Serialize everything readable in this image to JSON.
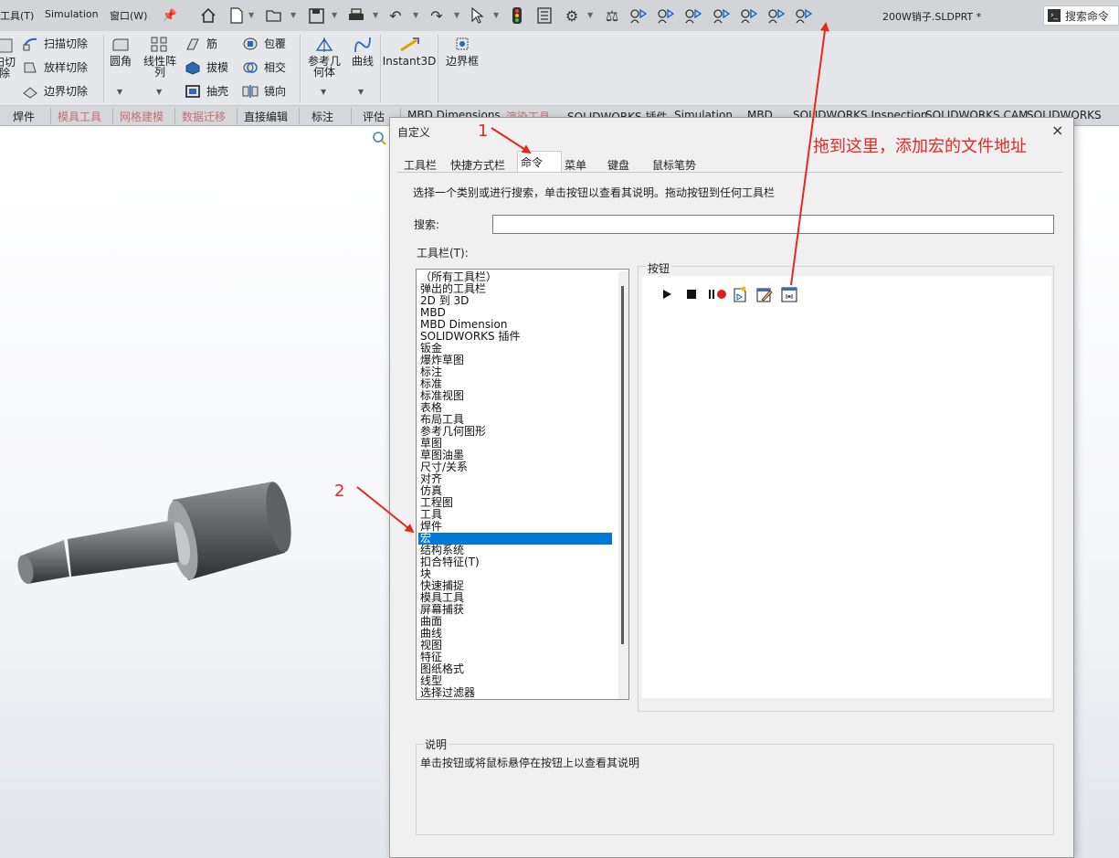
{
  "titlebar": {
    "menus": [
      "工具(T)",
      "Simulation",
      "窗口(W)"
    ],
    "document_title": "200W销子.SLDPRT *",
    "search_placeholder": "搜索命令"
  },
  "ribbon": {
    "partial_left": [
      "扫切",
      "除"
    ],
    "sweep_cut": "扫描切除",
    "loft_cut": "放样切除",
    "boundary_cut": "边界切除",
    "fillet": "圆角",
    "linear_pattern": "线性阵列",
    "rib": "筋",
    "draft": "拔模",
    "shell": "抽壳",
    "wrap": "包覆",
    "intersect": "相交",
    "mirror": "镜向",
    "ref_geometry": "参考几何体",
    "curves": "曲线",
    "instant3d": "Instant3D",
    "bounding_box": "边界框"
  },
  "tabs": [
    {
      "label": "焊件",
      "dim": false
    },
    {
      "label": "模具工具",
      "dim": true
    },
    {
      "label": "网格建模",
      "dim": true
    },
    {
      "label": "数据迁移",
      "dim": true
    },
    {
      "label": "直接编辑",
      "dim": false
    },
    {
      "label": "标注",
      "dim": false
    },
    {
      "label": "评估",
      "dim": false
    },
    {
      "label": "MBD Dimensions",
      "dim": false
    },
    {
      "label": "渲染工具",
      "dim": true
    },
    {
      "label": "SOLIDWORKS 插件",
      "dim": false
    },
    {
      "label": "Simulation",
      "dim": false
    },
    {
      "label": "MBD",
      "dim": false
    },
    {
      "label": "SOLIDWORKS Inspection",
      "dim": false
    },
    {
      "label": "SOLIDWORKS CAM",
      "dim": false
    },
    {
      "label": "SOLIDWORKS CAM",
      "dim": false
    }
  ],
  "dialog": {
    "title": "自定义",
    "close": "×",
    "tabs": [
      "工具栏",
      "快捷方式栏",
      "命令",
      "菜单",
      "键盘",
      "鼠标笔势"
    ],
    "active_tab": "命令",
    "instruction": "选择一个类别或进行搜索，单击按钮以查看其说明。拖动按钮到任何工具栏",
    "search_label": "搜索:",
    "search_value": "",
    "toolbar_label": "工具栏(T):",
    "toolbar_list": [
      "（所有工具栏）",
      "弹出的工具栏",
      "2D 到 3D",
      "MBD",
      "MBD Dimension",
      "SOLIDWORKS 插件",
      "钣金",
      "爆炸草图",
      "标注",
      "标准",
      "标准视图",
      "表格",
      "布局工具",
      "参考几何图形",
      "草图",
      "草图油墨",
      "尺寸/关系",
      "对齐",
      "仿真",
      "工程图",
      "工具",
      "焊件",
      "宏",
      "结构系统",
      "扣合特征(T)",
      "块",
      "快速捕捉",
      "模具工具",
      "屏幕捕获",
      "曲面",
      "曲线",
      "视图",
      "特征",
      "图纸格式",
      "线型",
      "选择过滤器"
    ],
    "selected_item": "宏",
    "buttons_label": "按钮",
    "macro_buttons": [
      "play-icon",
      "stop-icon",
      "pause-record-icon",
      "new-macro-icon",
      "edit-macro-icon",
      "custom-macro-icon"
    ],
    "description_label": "说明",
    "description_text": "单击按钮或将鼠标悬停在按钮上以查看其说明"
  },
  "annotations": {
    "step1": "1",
    "step2": "2",
    "drag_hint": "拖到这里，添加宏的文件地址",
    "color": "#e8271e"
  }
}
